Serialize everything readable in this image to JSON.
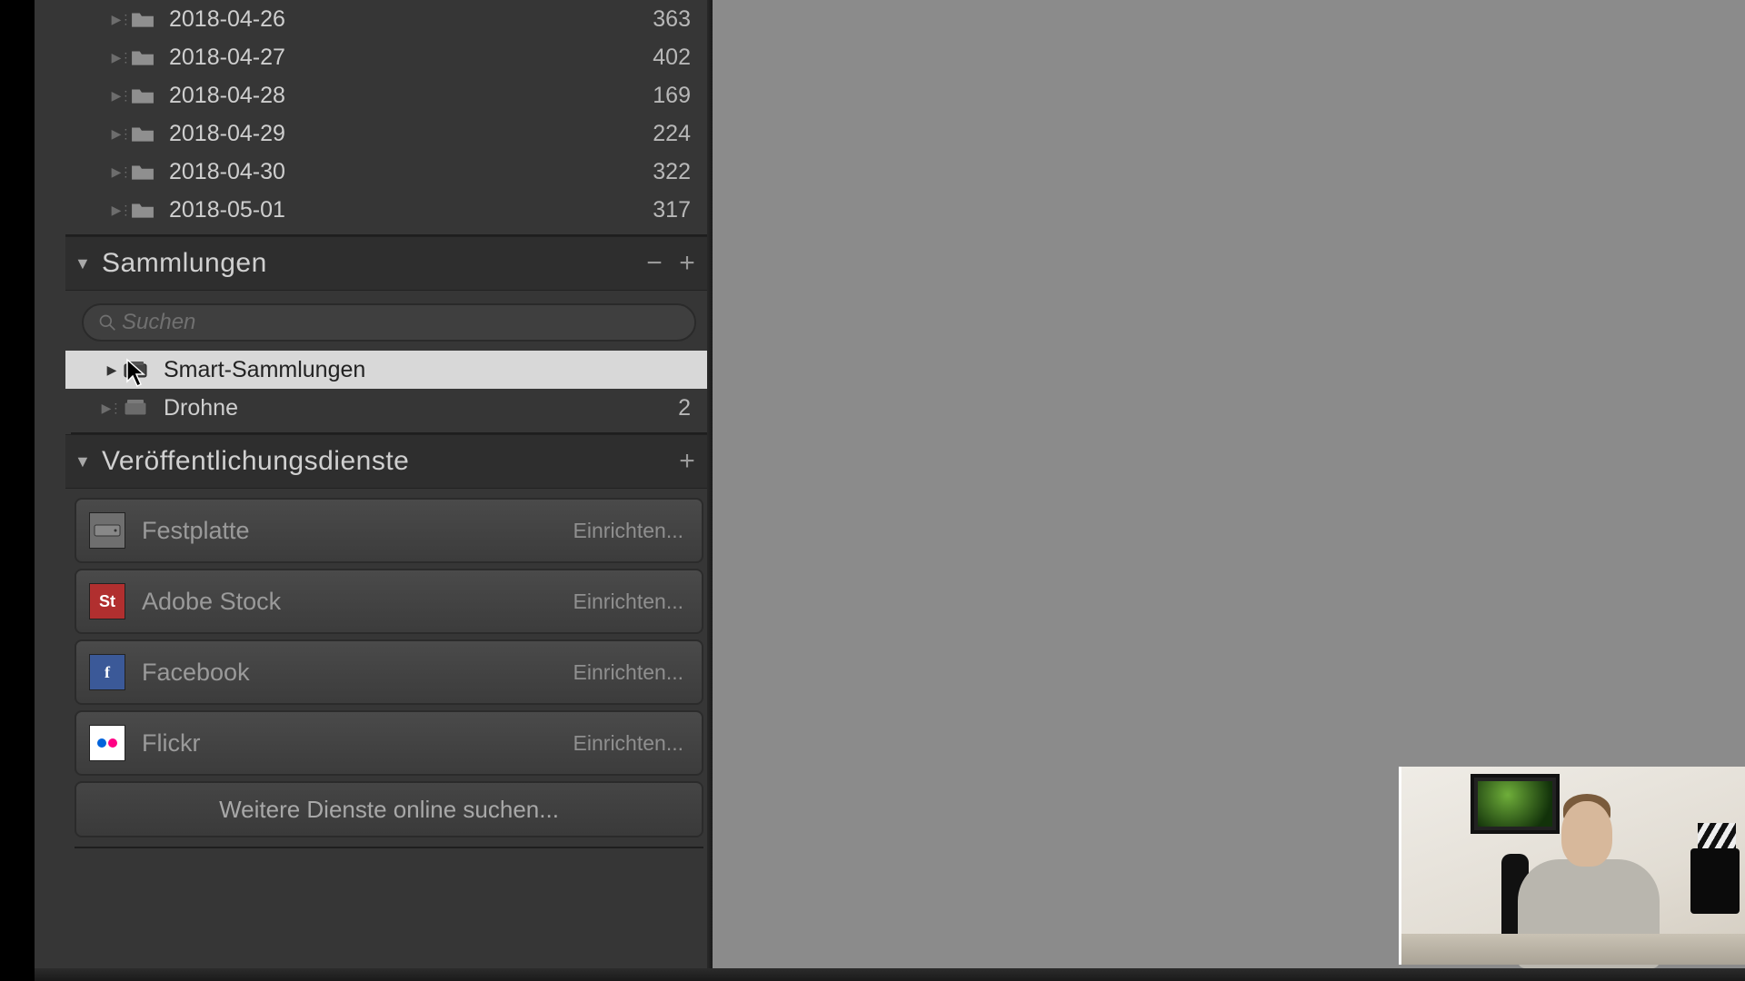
{
  "folders": [
    {
      "name": "2018-04-26",
      "count": "363"
    },
    {
      "name": "2018-04-27",
      "count": "402"
    },
    {
      "name": "2018-04-28",
      "count": "169"
    },
    {
      "name": "2018-04-29",
      "count": "224"
    },
    {
      "name": "2018-04-30",
      "count": "322"
    },
    {
      "name": "2018-05-01",
      "count": "317"
    }
  ],
  "collections": {
    "title": "Sammlungen",
    "search_placeholder": "Suchen",
    "items": [
      {
        "name": "Smart-Sammlungen",
        "count": "",
        "selected": true
      },
      {
        "name": "Drohne",
        "count": "2",
        "selected": false
      }
    ]
  },
  "publish": {
    "title": "Veröffentlichungsdienste",
    "setup_label": "Einrichten...",
    "more_label": "Weitere Dienste online suchen...",
    "services": [
      {
        "name": "Festplatte",
        "icon": "hdd"
      },
      {
        "name": "Adobe Stock",
        "icon": "st"
      },
      {
        "name": "Facebook",
        "icon": "fb"
      },
      {
        "name": "Flickr",
        "icon": "flickr"
      }
    ]
  }
}
